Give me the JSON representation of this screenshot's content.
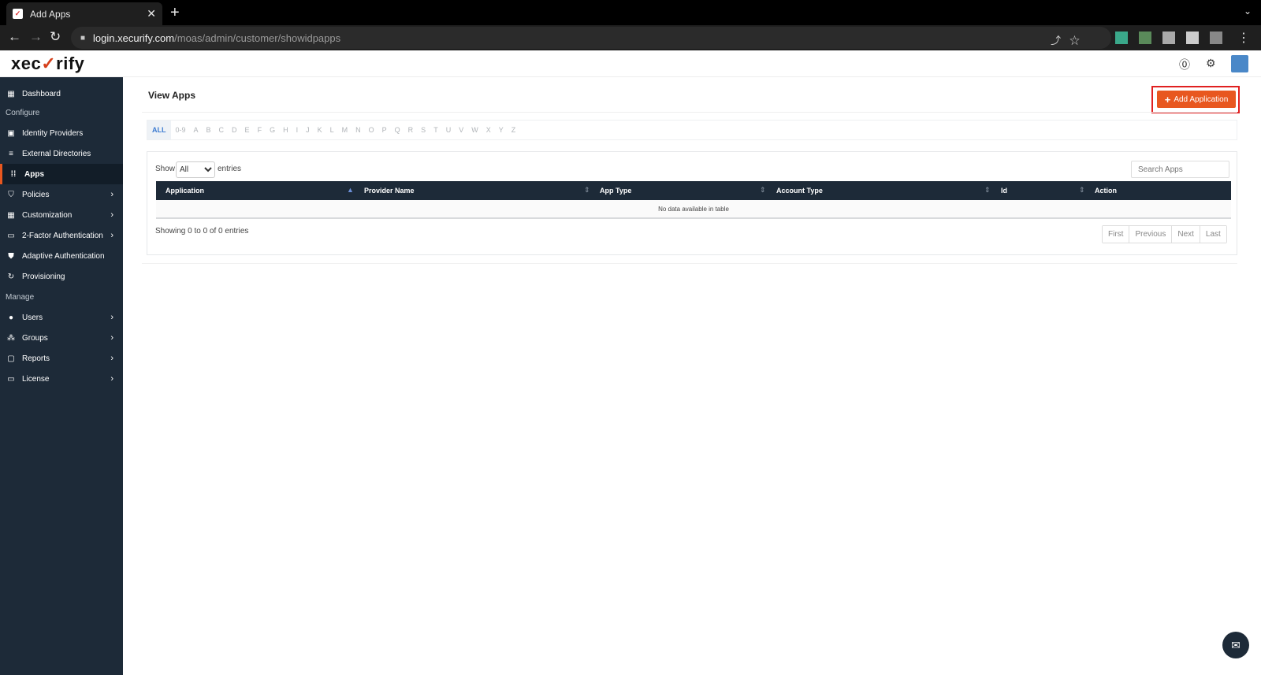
{
  "browser": {
    "tab_title": "Add Apps",
    "url_host": "login.xecurify.com",
    "url_path": "/moas/admin/customer/showidpapps"
  },
  "header": {
    "logo_text_left": "xec",
    "logo_text_right": "rify"
  },
  "sidebar": {
    "items": [
      {
        "label": "Dashboard",
        "icon": "dashboard-icon"
      },
      {
        "label": "Identity Providers",
        "icon": "building-icon"
      },
      {
        "label": "External Directories",
        "icon": "list-icon"
      },
      {
        "label": "Apps",
        "icon": "grid-icon"
      },
      {
        "label": "Policies",
        "icon": "shield-icon"
      },
      {
        "label": "Customization",
        "icon": "customize-icon"
      },
      {
        "label": "2-Factor Authentication",
        "icon": "keypad-icon"
      },
      {
        "label": "Adaptive Authentication",
        "icon": "shield-check-icon"
      },
      {
        "label": "Provisioning",
        "icon": "sync-icon"
      },
      {
        "label": "Users",
        "icon": "user-icon"
      },
      {
        "label": "Groups",
        "icon": "group-icon"
      },
      {
        "label": "Reports",
        "icon": "clipboard-icon"
      },
      {
        "label": "License",
        "icon": "card-icon"
      }
    ],
    "section_configure": "Configure",
    "section_manage": "Manage"
  },
  "main": {
    "page_title": "View Apps",
    "add_button_label": "Add Application",
    "alphabet": [
      "ALL",
      "0-9",
      "A",
      "B",
      "C",
      "D",
      "E",
      "F",
      "G",
      "H",
      "I",
      "J",
      "K",
      "L",
      "M",
      "N",
      "O",
      "P",
      "Q",
      "R",
      "S",
      "T",
      "U",
      "V",
      "W",
      "X",
      "Y",
      "Z"
    ],
    "show_label": "Show",
    "entries_label": "entries",
    "show_selected": "All",
    "search_placeholder": "Search Apps",
    "columns": [
      "Application",
      "Provider Name",
      "App Type",
      "Account Type",
      "Id",
      "Action"
    ],
    "empty_message": "No data available in table",
    "info_text": "Showing 0 to 0 of 0 entries",
    "pager": [
      "First",
      "Previous",
      "Next",
      "Last"
    ]
  },
  "colors": {
    "sidebar_bg": "#1d2a38",
    "accent": "#e8571f",
    "highlight_border": "#e02020"
  }
}
